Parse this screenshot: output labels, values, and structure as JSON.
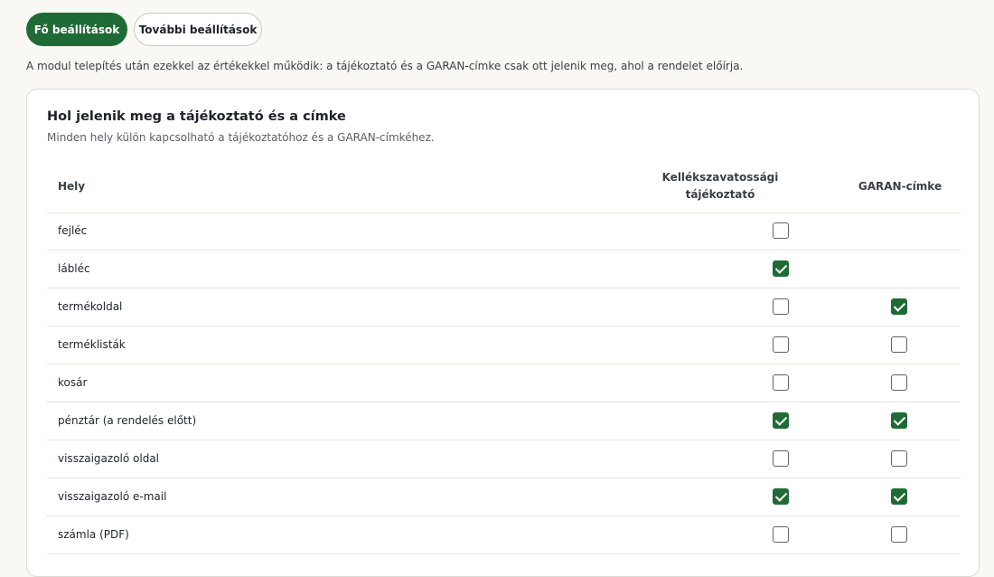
{
  "tabs": [
    {
      "label": "Fő beállítások",
      "active": true
    },
    {
      "label": "További beállítások",
      "active": false
    }
  ],
  "intro": "A modul telepítés után ezekkel az értékekkel működik: a tájékoztató és a GARAN-címke csak ott jelenik meg, ahol a rendelet előírja.",
  "card": {
    "title": "Hol jelenik meg a tájékoztató és a címke",
    "subtitle": "Minden hely külön kapcsolható a tájékoztatóhoz és a GARAN-címkéhez.",
    "columns": {
      "place": "Hely",
      "notice_line1": "Kellékszavatossági",
      "notice_line2": "tájékoztató",
      "label": "GARAN-címke"
    },
    "rows": [
      {
        "label": "fejléc",
        "notice": false,
        "garan": null
      },
      {
        "label": "lábléc",
        "notice": true,
        "garan": null
      },
      {
        "label": "termékoldal",
        "notice": false,
        "garan": true
      },
      {
        "label": "terméklisták",
        "notice": false,
        "garan": false
      },
      {
        "label": "kosár",
        "notice": false,
        "garan": false
      },
      {
        "label": "pénztár (a rendelés előtt)",
        "notice": true,
        "garan": true
      },
      {
        "label": "visszaigazoló oldal",
        "notice": false,
        "garan": false
      },
      {
        "label": "visszaigazoló e-mail",
        "notice": true,
        "garan": true
      },
      {
        "label": "számla (PDF)",
        "notice": false,
        "garan": false
      }
    ]
  },
  "colors": {
    "accent": "#1f6b35",
    "background": "#f9f8f4"
  },
  "icons": {
    "checked": "checkbox-checked-icon",
    "unchecked": "checkbox-empty-icon"
  }
}
